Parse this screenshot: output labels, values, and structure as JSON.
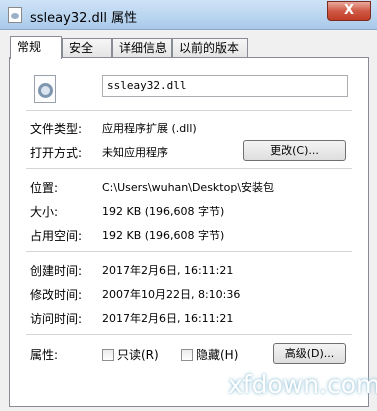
{
  "window": {
    "title": "ssleay32.dll 属性",
    "close_label": "X"
  },
  "tabs": [
    {
      "label": "常规",
      "active": true
    },
    {
      "label": "安全",
      "active": false
    },
    {
      "label": "详细信息",
      "active": false
    },
    {
      "label": "以前的版本",
      "active": false
    }
  ],
  "general": {
    "file_icon": "dll-file-gear-icon",
    "filename": "ssleay32.dll",
    "file_type_label": "文件类型:",
    "file_type_value": "应用程序扩展 (.dll)",
    "opens_with_label": "打开方式:",
    "opens_with_value": "未知应用程序",
    "change_button": "更改(C)...",
    "location_label": "位置:",
    "location_value": "C:\\Users\\wuhan\\Desktop\\安装包",
    "size_label": "大小:",
    "size_value": "192 KB (196,608 字节)",
    "size_on_disk_label": "占用空间:",
    "size_on_disk_value": "192 KB (196,608 字节)",
    "created_label": "创建时间:",
    "created_value": "2017年2月6日, 16:11:21",
    "modified_label": "修改时间:",
    "modified_value": "2007年10月22日, 8:10:36",
    "accessed_label": "访问时间:",
    "accessed_value": "2017年2月6日, 16:11:21",
    "attributes_label": "属性:",
    "readonly_label": "只读(R)",
    "readonly_checked": false,
    "hidden_label": "隐藏(H)",
    "hidden_checked": false,
    "advanced_button": "高级(D)..."
  },
  "watermark": "xfdown.com"
}
